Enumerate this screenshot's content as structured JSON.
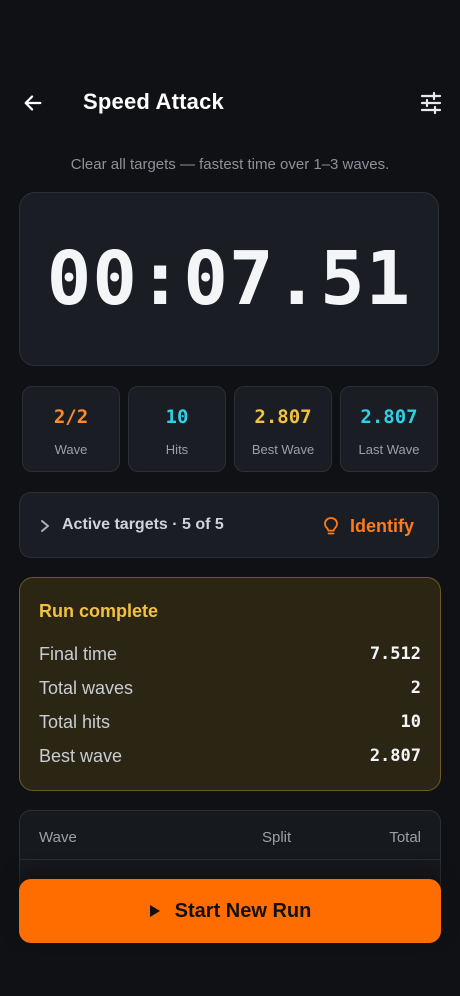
{
  "header": {
    "title": "Speed Attack",
    "subtitle": "Clear all targets — fastest time over 1–3 waves."
  },
  "timer": {
    "display": "00:07.51"
  },
  "stats": [
    {
      "value": "2/2",
      "label": "Wave",
      "color": "#ff8a2a"
    },
    {
      "value": "10",
      "label": "Hits",
      "color": "#2fd0e6"
    },
    {
      "value": "2.807",
      "label": "Best Wave",
      "color": "#f4c03f"
    },
    {
      "value": "2.807",
      "label": "Last Wave",
      "color": "#2fd0e6"
    }
  ],
  "targets": {
    "label": "Active targets · 5 of 5",
    "identify_label": "Identify"
  },
  "run_complete": {
    "title": "Run complete",
    "rows": [
      {
        "key": "Final time",
        "value": "7.512"
      },
      {
        "key": "Total waves",
        "value": "2"
      },
      {
        "key": "Total hits",
        "value": "10"
      },
      {
        "key": "Best wave",
        "value": "2.807"
      }
    ]
  },
  "wave_table": {
    "headers": {
      "wave": "Wave",
      "split": "Split",
      "total": "Total"
    }
  },
  "start_button": {
    "label": "Start New Run"
  },
  "colors": {
    "accent": "#ff6d00",
    "gold": "#f4c03f",
    "cyan": "#2fd0e6",
    "background": "#0f1115"
  },
  "icons": {
    "back": "arrow-left-icon",
    "settings": "sliders-icon",
    "chevron": "chevron-right-icon",
    "identify": "lightbulb-icon",
    "play": "play-icon"
  }
}
